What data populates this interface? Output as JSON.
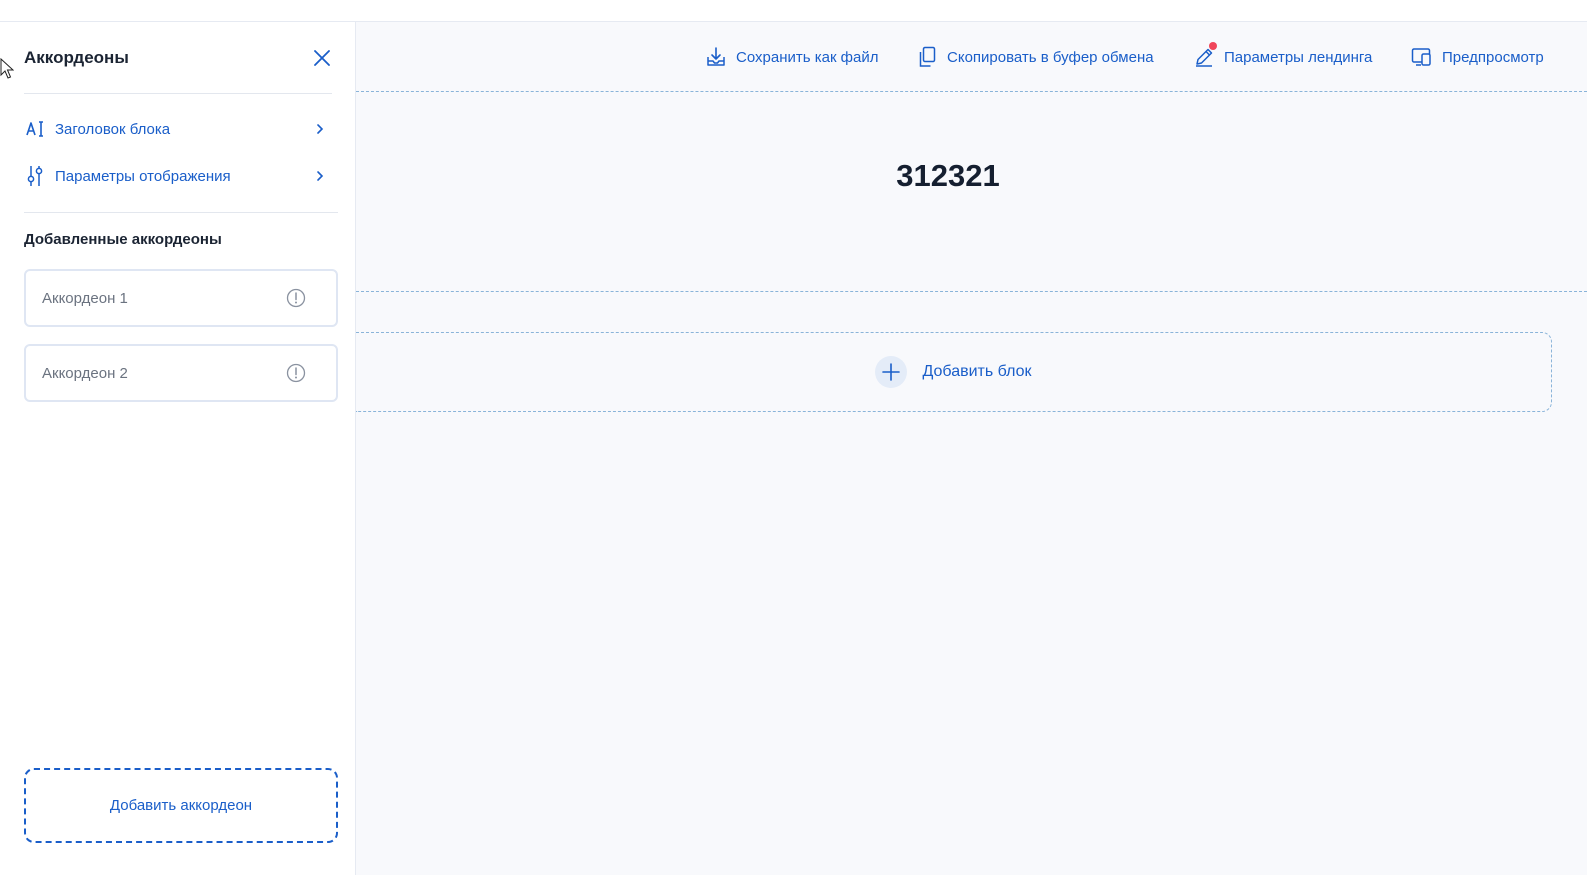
{
  "sidebar": {
    "title": "Аккордеоны",
    "menu": [
      {
        "label": "Заголовок блока",
        "icon": "text-cursor-icon"
      },
      {
        "label": "Параметры отображения",
        "icon": "sliders-icon"
      }
    ],
    "section_title": "Добавленные аккордеоны",
    "accordions": [
      {
        "name": "Аккордеон 1",
        "status_icon": "warning-circle-icon"
      },
      {
        "name": "Аккордеон 2",
        "status_icon": "warning-circle-icon"
      }
    ],
    "add_button": "Добавить аккордеон"
  },
  "toolbar": {
    "save_file": "Сохранить как файл",
    "copy_clipboard": "Скопировать в буфер обмена",
    "landing_params": "Параметры лендинга",
    "preview": "Предпросмотр"
  },
  "main": {
    "block_title": "312321",
    "add_block": "Добавить блок"
  },
  "colors": {
    "accent": "#1a5ec9",
    "notification_dot": "#f0455a",
    "background": "#f8f9fc"
  }
}
